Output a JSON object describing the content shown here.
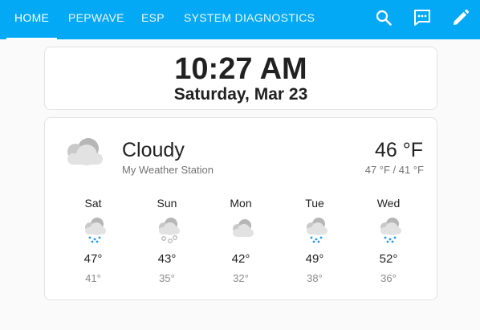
{
  "nav": {
    "tabs": [
      {
        "label": "HOME",
        "active": true
      },
      {
        "label": "PEPWAVE",
        "active": false
      },
      {
        "label": "ESP",
        "active": false
      },
      {
        "label": "SYSTEM DIAGNOSTICS",
        "active": false
      }
    ],
    "actions": [
      "search-icon",
      "assist-chat-icon",
      "edit-pencil-icon"
    ],
    "bar_color": "#03a9f4"
  },
  "clock": {
    "time": "10:27 AM",
    "date": "Saturday, Mar 23"
  },
  "weather": {
    "condition": "Cloudy",
    "station": "My Weather Station",
    "temperature": "46 °F",
    "high_low": "47 °F / 41 °F",
    "condition_icon": "cloudy-icon",
    "forecast": [
      {
        "day": "Sat",
        "high": "47°",
        "low": "41°",
        "icon": "rain-icon"
      },
      {
        "day": "Sun",
        "high": "43°",
        "low": "35°",
        "icon": "snow-icon"
      },
      {
        "day": "Mon",
        "high": "42°",
        "low": "32°",
        "icon": "cloudy-icon"
      },
      {
        "day": "Tue",
        "high": "49°",
        "low": "38°",
        "icon": "rain-icon"
      },
      {
        "day": "Wed",
        "high": "52°",
        "low": "36°",
        "icon": "rain-icon"
      }
    ]
  }
}
